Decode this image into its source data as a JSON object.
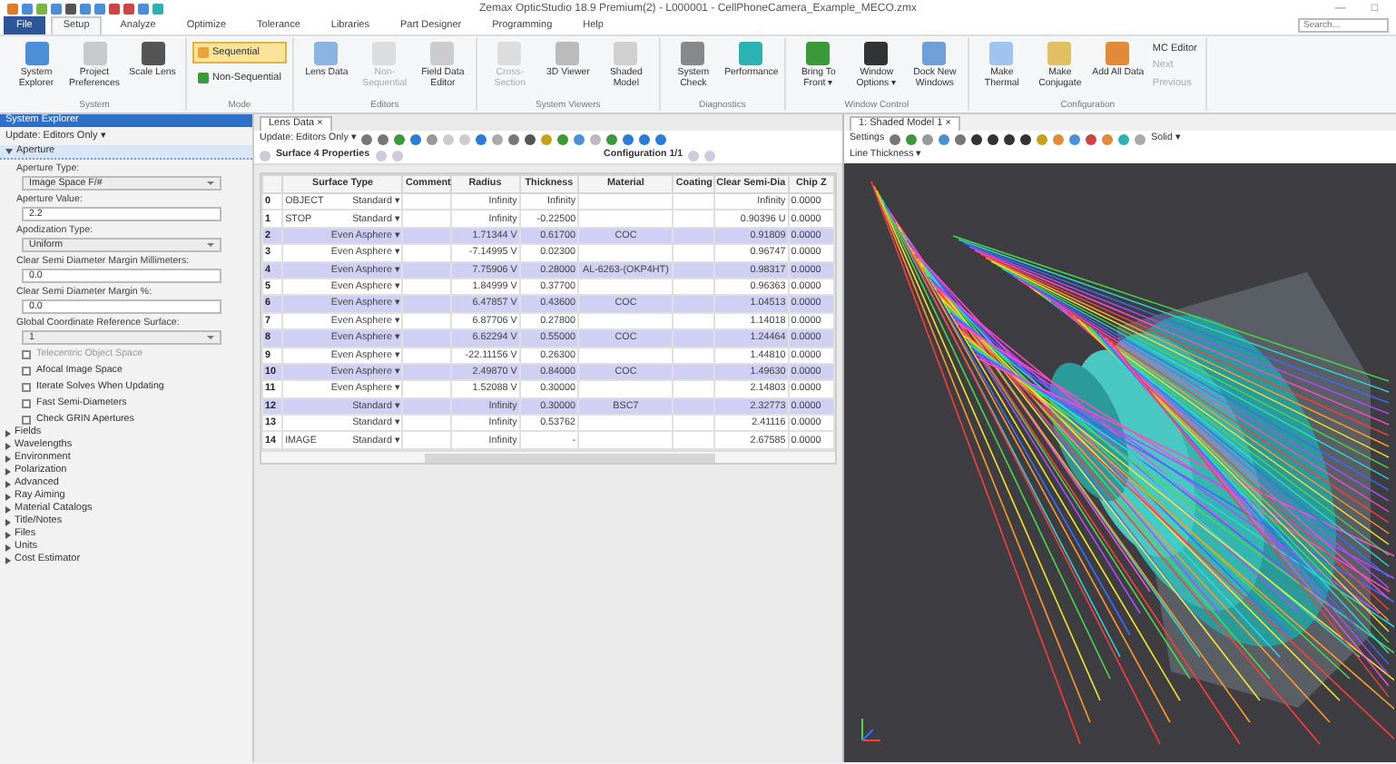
{
  "window": {
    "title": "Zemax OpticStudio 18.9   Premium(2) - L000001 - CellPhoneCamera_Example_MECO.zmx",
    "controls": [
      "—",
      "□"
    ]
  },
  "search": {
    "placeholder": "Search..."
  },
  "menu_tabs": [
    {
      "label": "File",
      "kind": "file",
      "selected": false
    },
    {
      "label": "Setup",
      "kind": "tab",
      "selected": true
    },
    {
      "label": "Analyze",
      "kind": "tab",
      "selected": false
    },
    {
      "label": "Optimize",
      "kind": "tab",
      "selected": false
    },
    {
      "label": "Tolerance",
      "kind": "tab",
      "selected": false
    },
    {
      "label": "Libraries",
      "kind": "tab",
      "selected": false
    },
    {
      "label": "Part Designer",
      "kind": "tab",
      "selected": false
    },
    {
      "label": "Programming",
      "kind": "tab",
      "selected": false
    },
    {
      "label": "Help",
      "kind": "tab",
      "selected": false
    }
  ],
  "ribbon_groups": [
    {
      "label": "System",
      "buttons": [
        {
          "label": "System Explorer",
          "disabled": false
        },
        {
          "label": "Project Preferences",
          "disabled": false
        },
        {
          "label": "Scale Lens",
          "disabled": false
        }
      ]
    },
    {
      "label": "Mode",
      "options": [
        {
          "label": "Sequential",
          "selected": true
        },
        {
          "label": "Non-Sequential",
          "selected": false
        }
      ]
    },
    {
      "label": "Editors",
      "buttons": [
        {
          "label": "Lens Data",
          "disabled": false
        },
        {
          "label": "Non-Sequential",
          "disabled": true
        },
        {
          "label": "Field Data Editor",
          "disabled": false
        }
      ]
    },
    {
      "label": "System Viewers",
      "buttons": [
        {
          "label": "Cross-Section",
          "disabled": true
        },
        {
          "label": "3D Viewer",
          "disabled": false
        },
        {
          "label": "Shaded Model",
          "disabled": false
        }
      ]
    },
    {
      "label": "Diagnostics",
      "buttons": [
        {
          "label": "System Check",
          "disabled": false
        },
        {
          "label": "Performance",
          "disabled": false
        }
      ]
    },
    {
      "label": "Window Control",
      "buttons": [
        {
          "label": "Bring To Front ▾",
          "disabled": false
        },
        {
          "label": "Window Options ▾",
          "disabled": false
        },
        {
          "label": "Dock New Windows",
          "disabled": false
        }
      ]
    },
    {
      "label": "Configuration",
      "buttons": [
        {
          "label": "Make Thermal",
          "disabled": false
        },
        {
          "label": "Make Conjugate",
          "disabled": false
        },
        {
          "label": "Add All Data",
          "disabled": false
        }
      ],
      "small_buttons": [
        {
          "label": "MC Editor",
          "disabled": false
        },
        {
          "label": "Next",
          "disabled": true
        },
        {
          "label": "Previous",
          "disabled": true
        }
      ]
    }
  ],
  "explorer": {
    "title": "System Explorer",
    "update_label": "Update: Editors Only ▾",
    "sections": [
      {
        "label": "Aperture",
        "expanded": true,
        "fields": [
          {
            "kind": "select",
            "label": "Aperture Type:",
            "value": "Image Space F/#"
          },
          {
            "kind": "input",
            "label": "Aperture Value:",
            "value": "2.2"
          },
          {
            "kind": "select",
            "label": "Apodization Type:",
            "value": "Uniform"
          },
          {
            "kind": "input",
            "label": "Clear Semi Diameter Margin Millimeters:",
            "value": "0.0"
          },
          {
            "kind": "input",
            "label": "Clear Semi Diameter Margin %:",
            "value": "0.0"
          },
          {
            "kind": "select",
            "label": "Global Coordinate Reference Surface:",
            "value": "1"
          },
          {
            "kind": "check",
            "label": "Telecentric Object Space",
            "checked": false,
            "disabled": true
          },
          {
            "kind": "check",
            "label": "Afocal Image Space",
            "checked": false,
            "disabled": false
          },
          {
            "kind": "check",
            "label": "Iterate Solves When Updating",
            "checked": false,
            "disabled": false
          },
          {
            "kind": "check",
            "label": "Fast Semi-Diameters",
            "checked": false,
            "disabled": false
          },
          {
            "kind": "check",
            "label": "Check GRIN Apertures",
            "checked": false,
            "disabled": false
          }
        ]
      },
      {
        "label": "Fields",
        "expanded": false
      },
      {
        "label": "Wavelengths",
        "expanded": false
      },
      {
        "label": "Environment",
        "expanded": false
      },
      {
        "label": "Polarization",
        "expanded": false
      },
      {
        "label": "Advanced",
        "expanded": false
      },
      {
        "label": "Ray Aiming",
        "expanded": false
      },
      {
        "label": "Material Catalogs",
        "expanded": false
      },
      {
        "label": "Title/Notes",
        "expanded": false
      },
      {
        "label": "Files",
        "expanded": false
      },
      {
        "label": "Units",
        "expanded": false
      },
      {
        "label": "Cost Estimator",
        "expanded": false
      }
    ]
  },
  "lens_editor": {
    "tab": "Lens Data",
    "close": "×",
    "update_label": "Update: Editors Only ▾",
    "surface_label": "Surface  4 Properties",
    "config_label": "Configuration 1/1",
    "columns": [
      "Surface Type",
      "Comment",
      "Radius",
      "Thickness",
      "Material",
      "Coating",
      "Clear Semi-Dia",
      "Chip Z"
    ],
    "rows": [
      {
        "num": "0",
        "name": "OBJECT",
        "type": "Standard ▾",
        "radius": "Infinity",
        "thickness": "Infinity",
        "semi_dia": "Infinity",
        "chip": "0.0000",
        "highlighted": false
      },
      {
        "num": "1",
        "name": "STOP",
        "type": "Standard ▾",
        "radius": "Infinity",
        "thickness": "-0.22500",
        "semi_dia": "0.90396",
        "semi_solve": "U",
        "chip": "0.0000",
        "highlighted": false
      },
      {
        "num": "2",
        "type": "Even Asphere ▾",
        "radius": "1.71344",
        "radius_solve": "V",
        "thickness": "0.61700",
        "material": "COC",
        "semi_dia": "0.91809",
        "chip": "0.0000",
        "highlighted": true
      },
      {
        "num": "3",
        "type": "Even Asphere ▾",
        "radius": "-7.14995",
        "radius_solve": "V",
        "thickness": "0.02300",
        "semi_dia": "0.96747",
        "chip": "0.0000",
        "highlighted": false
      },
      {
        "num": "4",
        "type": "Even Asphere ▾",
        "radius": "7.75906",
        "radius_solve": "V",
        "thickness": "0.28000",
        "material": "AL-6263-(OKP4HT)",
        "semi_dia": "0.98317",
        "chip": "0.0000",
        "highlighted": true
      },
      {
        "num": "5",
        "type": "Even Asphere ▾",
        "radius": "1.84999",
        "radius_solve": "V",
        "thickness": "0.37700",
        "semi_dia": "0.96363",
        "chip": "0.0000",
        "highlighted": false
      },
      {
        "num": "6",
        "type": "Even Asphere ▾",
        "radius": "6.47857",
        "radius_solve": "V",
        "thickness": "0.43600",
        "material": "COC",
        "semi_dia": "1.04513",
        "chip": "0.0000",
        "highlighted": true
      },
      {
        "num": "7",
        "type": "Even Asphere ▾",
        "radius": "6.87706",
        "radius_solve": "V",
        "thickness": "0.27800",
        "semi_dia": "1.14018",
        "chip": "0.0000",
        "highlighted": false
      },
      {
        "num": "8",
        "type": "Even Asphere ▾",
        "radius": "6.62294",
        "radius_solve": "V",
        "thickness": "0.55000",
        "material": "COC",
        "semi_dia": "1.24464",
        "chip": "0.0000",
        "highlighted": true
      },
      {
        "num": "9",
        "type": "Even Asphere ▾",
        "radius": "-22.11156",
        "radius_solve": "V",
        "thickness": "0.26300",
        "semi_dia": "1.44810",
        "chip": "0.0000",
        "highlighted": false
      },
      {
        "num": "10",
        "type": "Even Asphere ▾",
        "radius": "2.49870",
        "radius_solve": "V",
        "thickness": "0.84000",
        "material": "COC",
        "semi_dia": "1.49630",
        "chip": "0.0000",
        "highlighted": true
      },
      {
        "num": "11",
        "type": "Even Asphere ▾",
        "radius": "1.52088",
        "radius_solve": "V",
        "thickness": "0.30000",
        "semi_dia": "2.14803",
        "chip": "0.0000",
        "highlighted": false
      },
      {
        "num": "12",
        "type": "Standard ▾",
        "radius": "Infinity",
        "thickness": "0.30000",
        "material": "BSC7",
        "semi_dia": "2.32773",
        "chip": "0.0000",
        "highlighted": true
      },
      {
        "num": "13",
        "type": "Standard ▾",
        "radius": "Infinity",
        "thickness": "0.53762",
        "semi_dia": "2.41116",
        "chip": "0.0000",
        "highlighted": false
      },
      {
        "num": "14",
        "name": "IMAGE",
        "type": "Standard ▾",
        "radius": "Infinity",
        "thickness": "-",
        "semi_dia": "2.67585",
        "chip": "0.0000",
        "highlighted": false
      }
    ]
  },
  "shaded_model": {
    "tab": "1: Shaded Model 1",
    "close": "×",
    "settings": "Settings",
    "mode": "Solid ▾",
    "line_thickness": "Line Thickness ▾"
  }
}
